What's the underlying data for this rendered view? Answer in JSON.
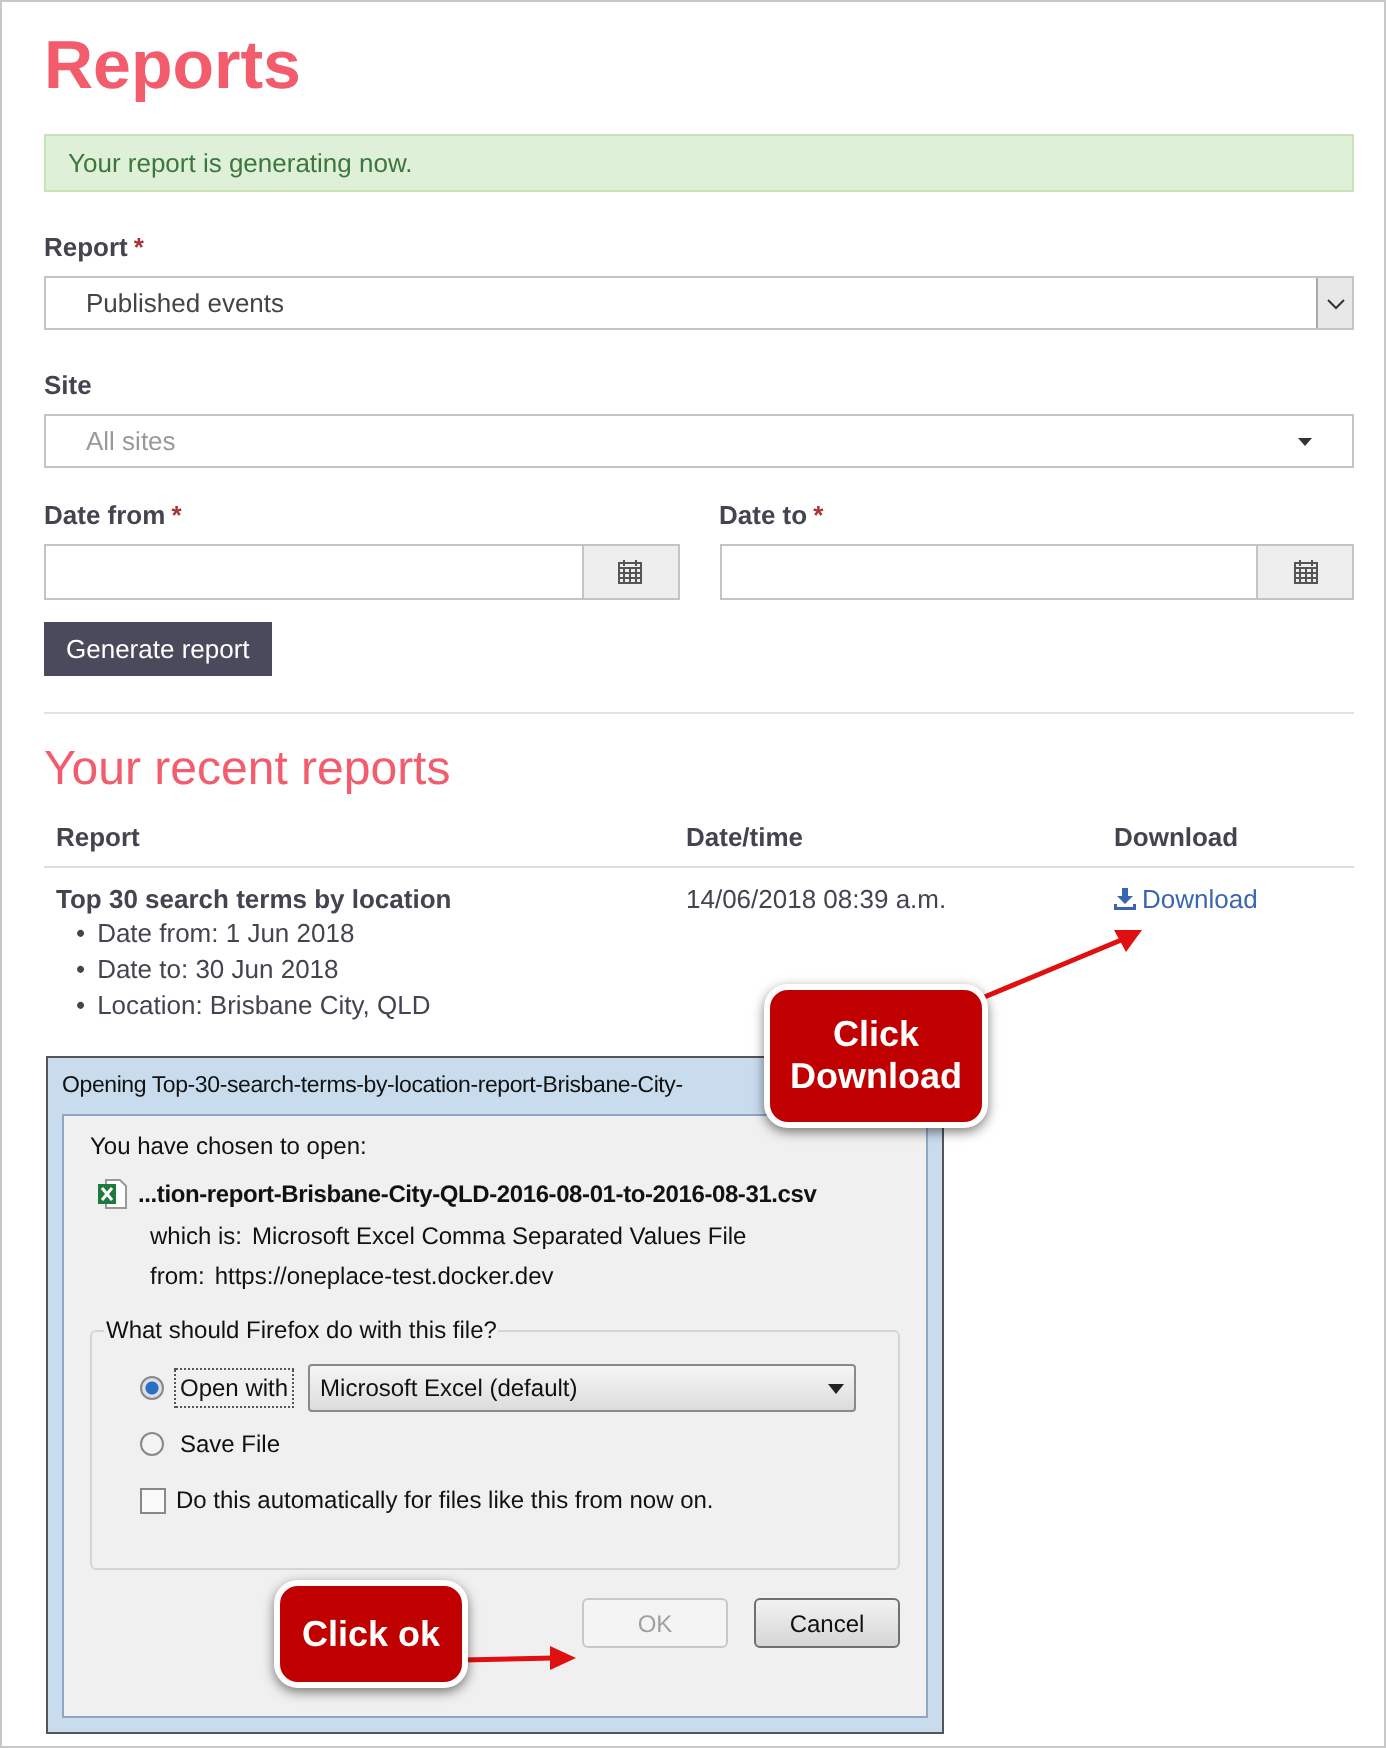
{
  "page": {
    "title": "Reports"
  },
  "alert": {
    "text": "Your report is generating now."
  },
  "form": {
    "fields": [
      {
        "kind": "select",
        "label": "Report",
        "required_mark": "*",
        "value": "Published events"
      },
      {
        "kind": "combo",
        "label": "Site",
        "placeholder": "All sites"
      }
    ],
    "dates": [
      {
        "label": "Date from",
        "required_mark": "*"
      },
      {
        "label": "Date to",
        "required_mark": "*"
      }
    ],
    "submit": "Generate report"
  },
  "recent": {
    "heading": "Your recent reports",
    "columns": [
      "Report",
      "Date/time",
      "Download"
    ],
    "rows": [
      {
        "title": "Top 30 search terms by location",
        "bullet": "•",
        "details": [
          "Date from: 1 Jun 2018",
          "Date to: 30 Jun 2018",
          "Location: Brisbane City, QLD"
        ],
        "datetime": "14/06/2018 08:39 a.m.",
        "link": "Download"
      }
    ]
  },
  "dialog": {
    "title": "Opening Top-30-search-terms-by-location-report-Brisbane-City-",
    "intro": "You have chosen to open:",
    "filename": "...tion-report-Brisbane-City-QLD-2016-08-01-to-2016-08-31.csv",
    "info": [
      {
        "label": "which is:",
        "value": "Microsoft Excel Comma Separated Values File"
      },
      {
        "label": "from:",
        "value": "https://oneplace-test.docker.dev"
      }
    ],
    "legend": "What should Firefox do with this file?",
    "options": [
      {
        "label": "Open with",
        "selected": true,
        "app": "Microsoft Excel (default)"
      },
      {
        "label": "Save File",
        "selected": false
      }
    ],
    "auto": {
      "label": "Do this automatically for files like this from now on.",
      "checked": false
    },
    "buttons": [
      {
        "label": "OK",
        "disabled": true
      },
      {
        "label": "Cancel",
        "disabled": false
      }
    ]
  },
  "callouts": [
    {
      "text": "Click Download"
    },
    {
      "text": "Click ok"
    }
  ]
}
